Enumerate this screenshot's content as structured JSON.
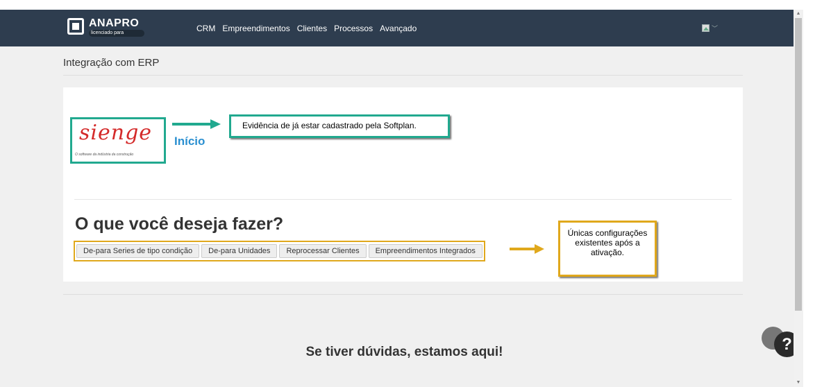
{
  "app": {
    "brand": "ANAPRO",
    "brand_sub": "licenciado para"
  },
  "nav": {
    "items": [
      {
        "label": "CRM"
      },
      {
        "label": "Empreendimentos"
      },
      {
        "label": "Clientes"
      },
      {
        "label": "Processos"
      },
      {
        "label": "Avançado"
      }
    ],
    "user_icon": "broken-image-icon"
  },
  "page": {
    "title": "Integração com ERP"
  },
  "integration": {
    "logo_text": "sienge",
    "logo_tagline": "O software da indústria da construção",
    "status_label": "Início",
    "callout_teal": "Evidência de já estar cadastrado pela Softplan."
  },
  "actions": {
    "heading": "O que você deseja fazer?",
    "buttons": [
      {
        "label": "De-para Series de tipo condição"
      },
      {
        "label": "De-para Unidades"
      },
      {
        "label": "Reprocessar Clientes"
      },
      {
        "label": "Empreendimentos Integrados"
      }
    ],
    "callout_yellow": "Únicas configurações existentes após a ativação."
  },
  "help": {
    "text": "Se tiver dúvidas, estamos aqui!",
    "icon_label": "?"
  },
  "colors": {
    "navbar": "#2e3d4f",
    "teal_annotation": "#21a98f",
    "yellow_annotation": "#e0a81c",
    "sienge_red": "#d42a2a",
    "inicio_blue": "#2a8fd0"
  }
}
